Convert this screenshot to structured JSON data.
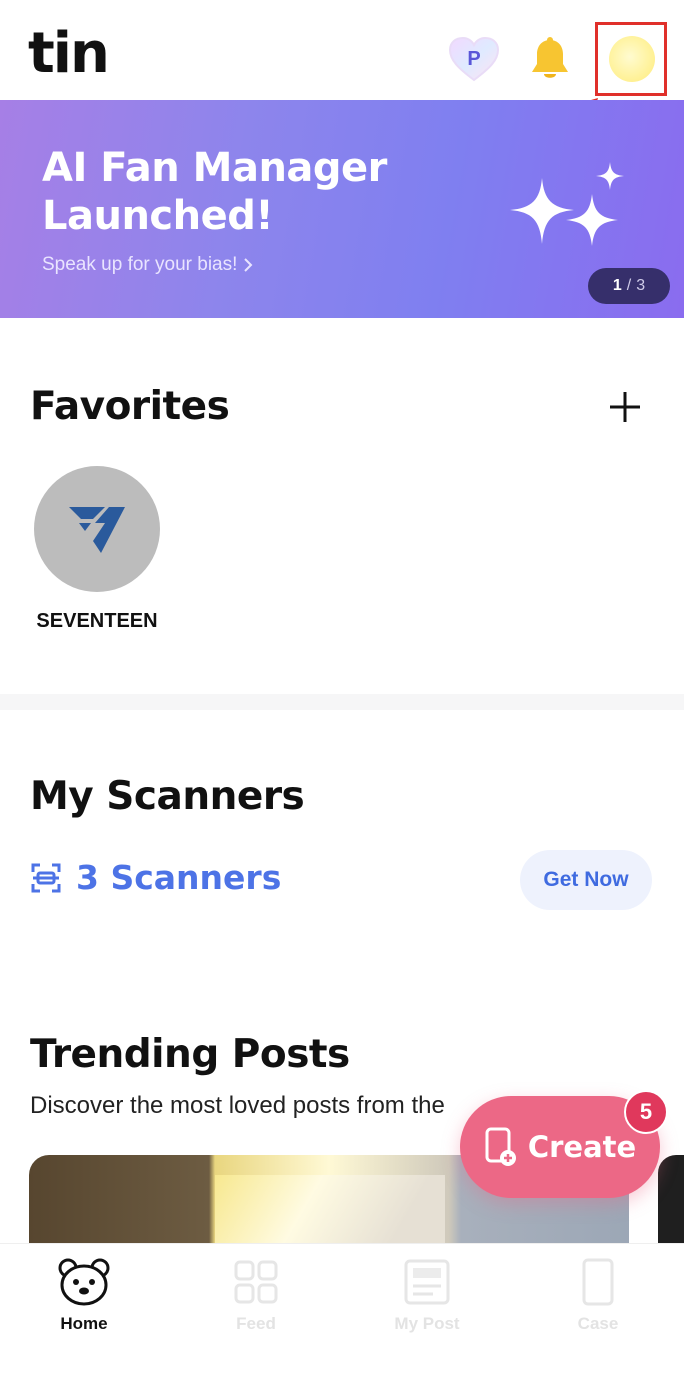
{
  "header": {
    "logo": "tin",
    "points_icon": "p-heart-icon",
    "notifications_icon": "bell-icon",
    "avatar_icon": "avatar"
  },
  "banner": {
    "title": "AI Fan Manager Launched!",
    "subtitle": "Speak up for your bias!",
    "page_current": "1",
    "page_separator": "/",
    "page_total": "3"
  },
  "favorites": {
    "title": "Favorites",
    "add_icon": "plus-icon",
    "items": [
      {
        "label": "SEVENTEEN"
      }
    ]
  },
  "scanners": {
    "title": "My Scanners",
    "count_label": "3 Scanners",
    "button_label": "Get Now"
  },
  "trending": {
    "title": "Trending Posts",
    "subtitle": "Discover the most loved posts from the"
  },
  "create": {
    "label": "Create",
    "badge": "5"
  },
  "nav": {
    "items": [
      {
        "label": "Home",
        "icon": "bear-icon",
        "active": true
      },
      {
        "label": "Feed",
        "icon": "grid-icon",
        "active": false
      },
      {
        "label": "My Post",
        "icon": "post-icon",
        "active": false
      },
      {
        "label": "Case",
        "icon": "phone-case-icon",
        "active": false
      }
    ]
  },
  "colors": {
    "accent_blue": "#4d73e6",
    "create_pink": "#ec6886",
    "badge_red": "#e0385c",
    "highlight_red": "#e0302a"
  }
}
